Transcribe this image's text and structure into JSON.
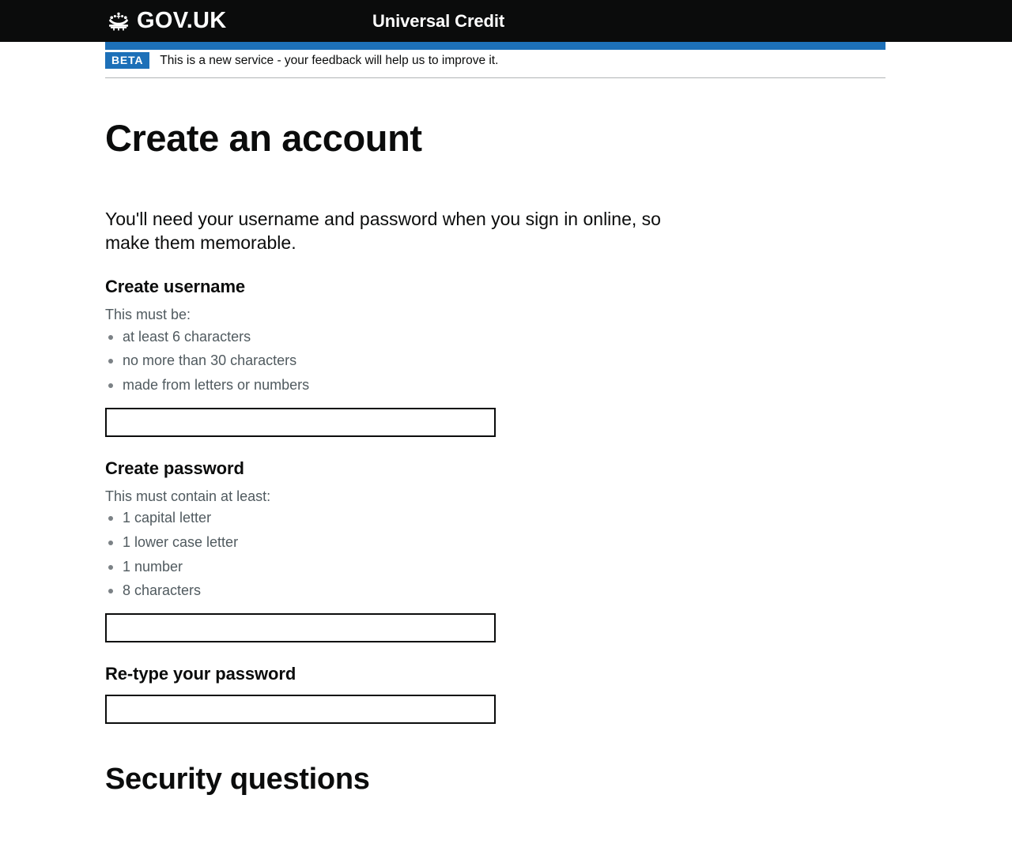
{
  "header": {
    "logo_text": "GOV.UK",
    "crown_icon": "crown-icon",
    "service_name": "Universal Credit"
  },
  "phase_banner": {
    "tag": "BETA",
    "text": "This is a new service - your feedback will help us to improve it."
  },
  "page": {
    "title": "Create an account",
    "intro": "You'll need your username and password when you sign in online, so make them memorable."
  },
  "username_section": {
    "heading": "Create username",
    "hint_intro": "This must be:",
    "hints": [
      "at least 6 characters",
      "no more than 30 characters",
      "made from letters or numbers"
    ],
    "input_value": "",
    "input_placeholder": ""
  },
  "password_section": {
    "heading": "Create password",
    "hint_intro": "This must contain at least:",
    "hints": [
      "1 capital letter",
      "1 lower case letter",
      "1 number",
      "8 characters"
    ],
    "input_value": "",
    "input_placeholder": ""
  },
  "retype_section": {
    "heading": "Re-type your password",
    "input_value": "",
    "input_placeholder": ""
  },
  "security_section": {
    "heading": "Security questions"
  },
  "colors": {
    "header_black": "#0b0c0c",
    "brand_blue": "#1d70b8",
    "hint_grey": "#505a5f",
    "divider_grey": "#b1b4b6",
    "page_background": "#ffffff"
  }
}
